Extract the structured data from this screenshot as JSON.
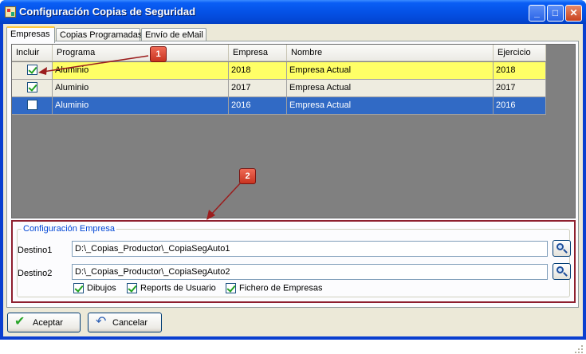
{
  "window": {
    "title": "Configuración Copias de Seguridad",
    "controls": {
      "minimize": "_",
      "maximize": "□",
      "close": "✕"
    }
  },
  "tabs": [
    {
      "label": "Empresas",
      "active": true
    },
    {
      "label": "Copias Programadas",
      "active": false
    },
    {
      "label": "Envío de eMail",
      "active": false
    }
  ],
  "grid": {
    "columns": [
      "Incluir",
      "Programa",
      "Empresa",
      "Nombre",
      "Ejercicio"
    ],
    "rows": [
      {
        "incluir": true,
        "programa": "Aluminio",
        "empresa": "2018",
        "nombre": "Empresa Actual",
        "ejercicio": "2018",
        "style": "yellow"
      },
      {
        "incluir": true,
        "programa": "Aluminio",
        "empresa": "2017",
        "nombre": "Empresa Actual",
        "ejercicio": "2017",
        "style": "grey"
      },
      {
        "incluir": false,
        "programa": "Aluminio",
        "empresa": "2016",
        "nombre": "Empresa Actual",
        "ejercicio": "2016",
        "style": "blue"
      }
    ]
  },
  "config": {
    "title": "Configuración Empresa",
    "destino1_label": "Destino1",
    "destino1_value": "D:\\_Copias_Productor\\_CopiaSegAuto1",
    "destino2_label": "Destino2",
    "destino2_value": "D:\\_Copias_Productor\\_CopiaSegAuto2",
    "options": [
      {
        "label": "Dibujos",
        "checked": true
      },
      {
        "label": "Reports de Usuario",
        "checked": true
      },
      {
        "label": "Fichero de Empresas",
        "checked": true
      }
    ]
  },
  "buttons": {
    "accept": "Aceptar",
    "cancel": "Cancelar"
  },
  "annotations": [
    "1",
    "2"
  ],
  "colors": {
    "annotation": "#c8331f",
    "highlight_yellow": "#ffff66",
    "selection_blue": "#316ac5"
  }
}
